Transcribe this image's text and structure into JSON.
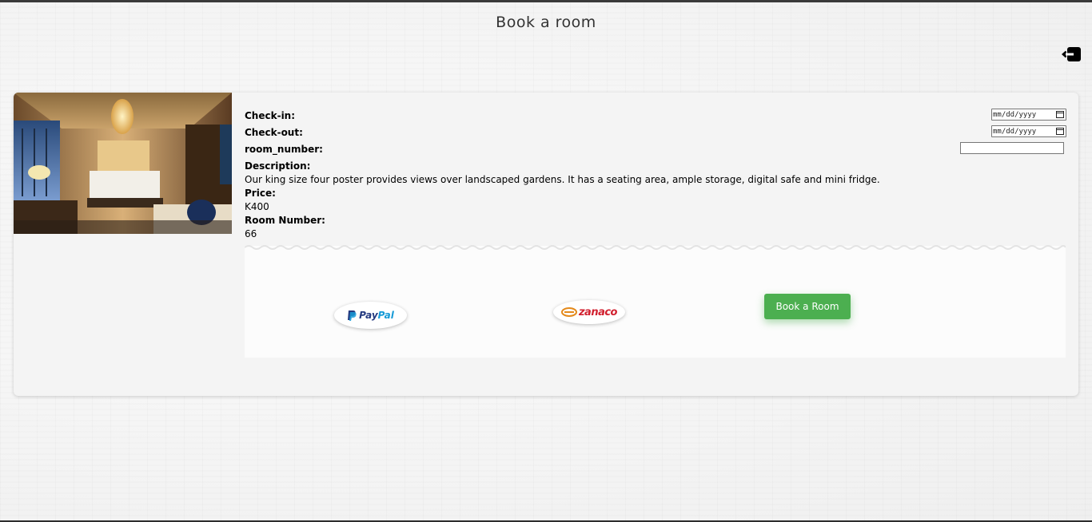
{
  "page": {
    "title": "Book a room"
  },
  "header": {
    "logout_icon": "logout-arrow-icon"
  },
  "booking_form": {
    "checkin_label": "Check-in:",
    "checkin_placeholder": "mm/dd/yyyy",
    "checkout_label": "Check-out:",
    "checkout_placeholder": "mm/dd/yyyy",
    "room_number_label": "room_number:",
    "room_number_value": ""
  },
  "room": {
    "image_alt": "hotel-room-photo",
    "description_label": "Description:",
    "description": "Our king size four poster provides views over landscaped gardens. It has a seating area, ample storage, digital safe and mini fridge.",
    "price_label": "Price:",
    "price": "K400",
    "room_number_label": "Room Number:",
    "room_number": "66"
  },
  "payment": {
    "paypal_pay": "Pay",
    "paypal_pal": "Pal",
    "zanaco": "zanaco",
    "book_button": "Book a Room"
  },
  "colors": {
    "accent_green": "#4caf50",
    "paypal_dark": "#253b80",
    "paypal_light": "#179bd7",
    "zanaco_red": "#d11f2e"
  }
}
